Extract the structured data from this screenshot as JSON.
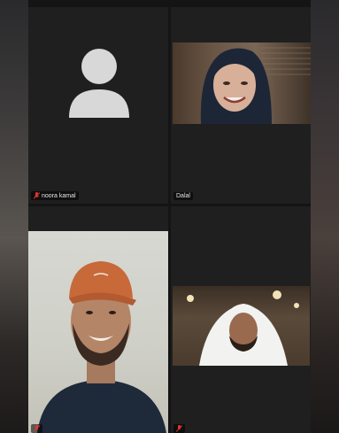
{
  "participants": [
    {
      "name": "noora kamal",
      "muted": true,
      "video": false
    },
    {
      "name": "Dalal",
      "muted": false,
      "video": true
    },
    {
      "name": "",
      "muted": true,
      "video": true
    },
    {
      "name": "",
      "muted": true,
      "video": true
    }
  ],
  "colors": {
    "tile_bg": "#1f1f1f",
    "avatar": "#d8d8d8",
    "muted_icon": "#e0362c",
    "name_text": "#e8e8e8"
  }
}
